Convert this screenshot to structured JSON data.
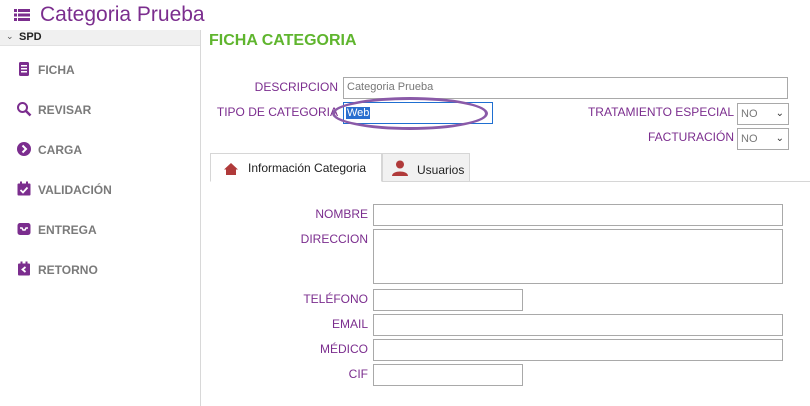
{
  "window": {
    "title": "Categoria Prueba"
  },
  "sidebar": {
    "section": "SPD",
    "items": [
      {
        "label": "FICHA",
        "icon": "document-icon"
      },
      {
        "label": "REVISAR",
        "icon": "search-icon"
      },
      {
        "label": "CARGA",
        "icon": "arrow-circle-icon"
      },
      {
        "label": "VALIDACIÓN",
        "icon": "check-calendar-icon"
      },
      {
        "label": "ENTREGA",
        "icon": "inbox-icon"
      },
      {
        "label": "RETORNO",
        "icon": "return-icon"
      }
    ]
  },
  "page": {
    "heading": "FICHA CATEGORIA"
  },
  "form": {
    "descripcion_label": "DESCRIPCION",
    "descripcion_value": "Categoria Prueba",
    "tipo_label": "TIPO DE CATEGORIA",
    "tipo_value": "Web",
    "tratamiento_label": "TRATAMIENTO ESPECIAL",
    "tratamiento_value": "NO",
    "facturacion_label": "FACTURACIÓN",
    "facturacion_value": "NO"
  },
  "tabs": [
    {
      "label": "Información Categoria",
      "icon": "home-icon",
      "active": true
    },
    {
      "label": "Usuarios",
      "icon": "user-icon",
      "active": false
    }
  ],
  "info": {
    "nombre_label": "NOMBRE",
    "nombre_value": "",
    "direccion_label": "DIRECCION",
    "direccion_value": "",
    "telefono_label": "TELÉFONO",
    "telefono_value": "",
    "email_label": "EMAIL",
    "email_value": "",
    "medico_label": "MÉDICO",
    "medico_value": "",
    "cif_label": "CIF",
    "cif_value": ""
  },
  "colors": {
    "brand": "#7b2d8e",
    "heading": "#5fb52e",
    "highlight": "#8a5aa8"
  }
}
